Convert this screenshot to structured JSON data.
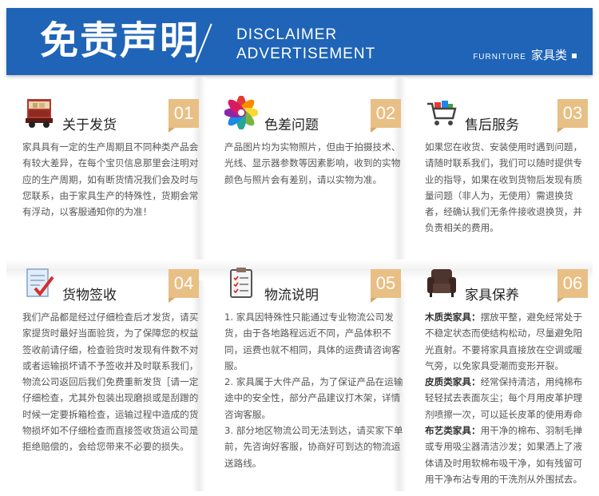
{
  "banner": {
    "title": "免责声明",
    "en_line1": "DISCLAIMER",
    "en_line2": "ADVERTISEMENT",
    "category_en": "FURNITURE",
    "category_cn": "家具类"
  },
  "cards": [
    {
      "number": "01",
      "title": "关于发货",
      "icon": "delivery-truck-icon",
      "body": "家具具有一定的生产周期且不同种类产品会有较大差异，在每个宝贝信息那里会注明对应的生产周期，如有断货情况我们会及时与您联系，由于家具生产的特殊性，货期会常有浮动，以客服通知你的为准！"
    },
    {
      "number": "02",
      "title": "色差问题",
      "icon": "color-wheel-icon",
      "body": "产品图片均为实物照片，但由于拍摄技术、光线、显示器参数等因素影响，收到的实物颜色与照片会有差别，请以实物为准。"
    },
    {
      "number": "03",
      "title": "售后服务",
      "icon": "shopping-cart-icon",
      "body": "如果您在收货、安装使用时遇到问题，请随时联系我们，我们可以随时提供专业的指导，如果在收到货物后发现有质量问题（非人为，无使用）需退换货者，经确认我们无条件接收退换货，并负责相关的费用。"
    },
    {
      "number": "04",
      "title": "货物签收",
      "icon": "signed-document-icon",
      "body": "我们产品都是经过仔细检查后才发货，请买家提货时最好当面验货，为了保障您的权益签收前请仔细，检查验货时发现有件数不对或者运输损坏请不予签收并及时联系我们，物流公司返回后我们免费重新发货［请一定仔细检查，尤其外包装出现磨损或是刮蹭的时候一定要拆箱检查，运输过程中造成的货物损坏如不仔细检查而直接签收货运公司是拒绝赔偿的，会给您带来不必要的损失。"
    },
    {
      "number": "05",
      "title": "物流说明",
      "icon": "clipboard-checklist-icon",
      "paragraphs": [
        "1. 家具因特殊性只能通过专业物流公司发货，由于各地路程远近不同，产品体积不同，运费也就不相同，具体的运费请咨询客服。",
        "2. 家具属于大件产品，为了保证产品在运输途中的安全性，部分产品建议打木架，详情咨询客服。",
        "3. 部分地区物流公司无法到达，请买家下单前，先咨询好客服，协商好可到达的物流运送路线。"
      ]
    },
    {
      "number": "06",
      "title": "家具保养",
      "icon": "armchair-icon",
      "care": [
        {
          "label": "木质类家具：",
          "text": "摆放平整，避免经常处于不稳定状态而使结构松动，尽量避免阳光直射。不要将家具直接放在空调或暖气旁，以免家具受潮而变形开裂。"
        },
        {
          "label": "皮质类家具：",
          "text": "经常保持清洁，用纯棉布轻轻拭去表面灰尘；每个月用皮革护理剂喷擦一次，可以延长皮革的使用寿命"
        },
        {
          "label": "布艺类家具：",
          "text": "用干净的棉布、羽制毛掸或专用吸尘器清洁沙发；如果洒上了液体请及时用软棉布吸干净，如有残留可用干净布沾专用的干洗剂从外围拭去。"
        }
      ]
    }
  ],
  "colors": {
    "banner_blue": "#1f64b7",
    "badge_tan": "#e8bf84"
  }
}
